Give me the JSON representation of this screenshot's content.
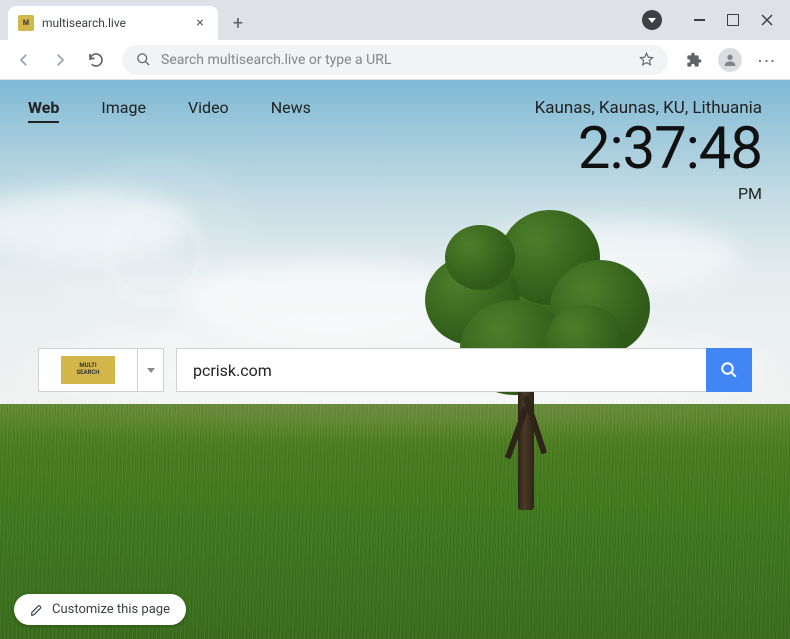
{
  "window": {
    "tab_title": "multisearch.live",
    "favicon_text": "M"
  },
  "toolbar": {
    "omnibox_placeholder": "Search multisearch.live or type a URL"
  },
  "nav": {
    "tabs": [
      {
        "label": "Web",
        "active": true
      },
      {
        "label": "Image",
        "active": false
      },
      {
        "label": "Video",
        "active": false
      },
      {
        "label": "News",
        "active": false
      }
    ]
  },
  "clock": {
    "location": "Kaunas, Kaunas, KU, Lithuania",
    "time": "2:37:48",
    "ampm": "PM"
  },
  "search": {
    "engine_label_top": "MULTI",
    "engine_label_bottom": "SEARCH",
    "input_value": "pcrisk.com"
  },
  "footer": {
    "customize_label": "Customize this page"
  },
  "colors": {
    "accent": "#4285f4",
    "engine_logo_bg": "#d4b74a"
  }
}
